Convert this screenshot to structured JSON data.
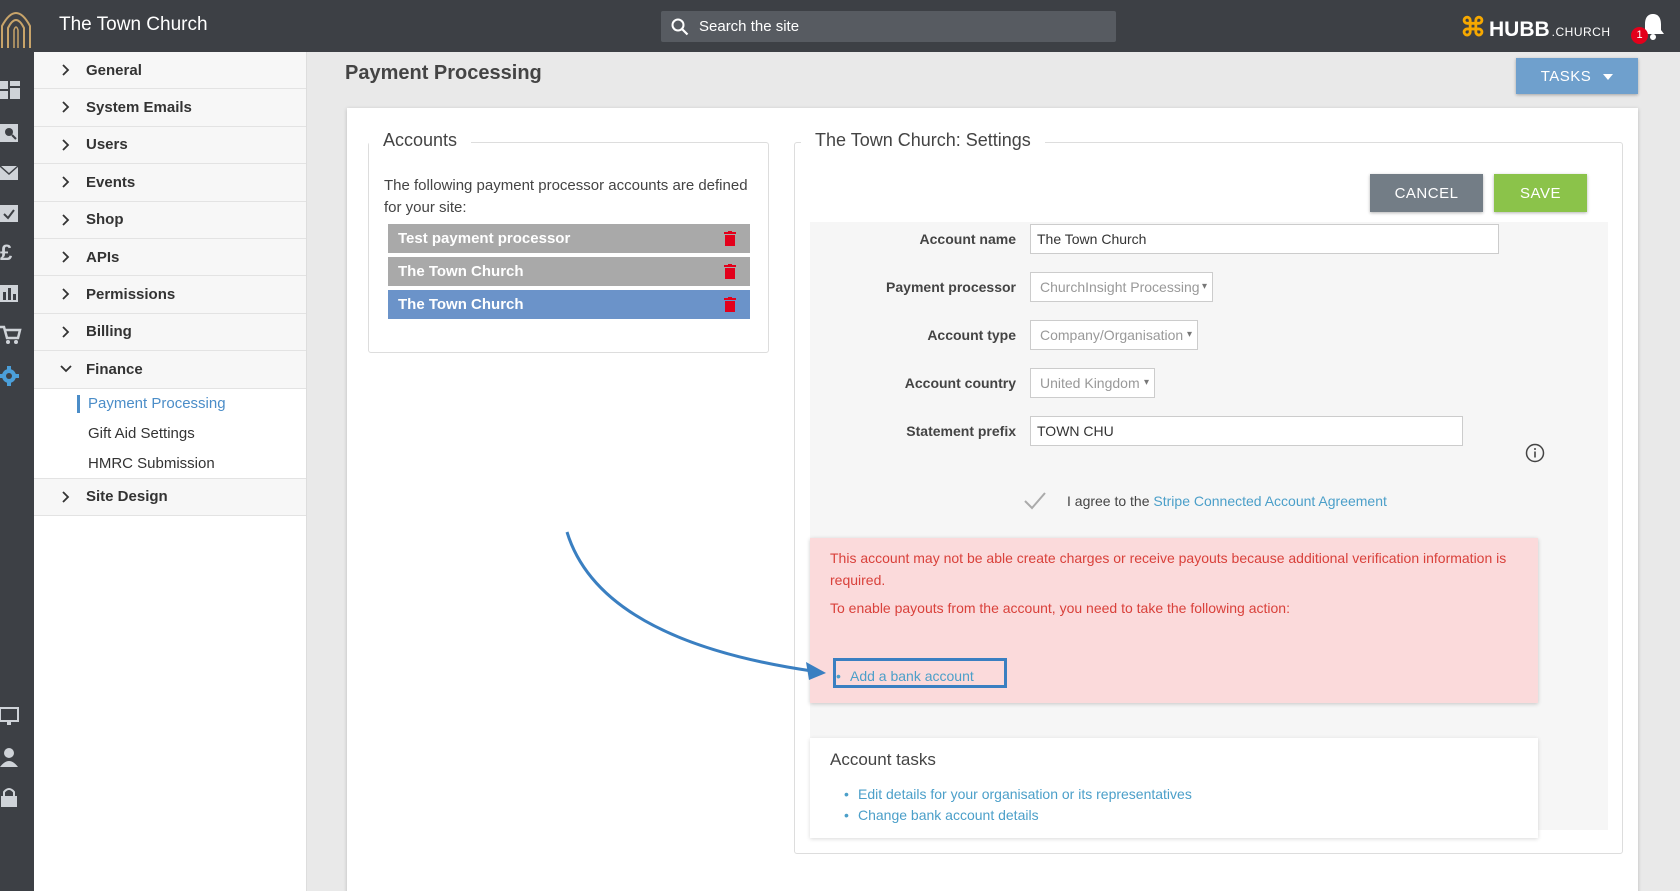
{
  "header": {
    "site_title": "The Town Church",
    "search_placeholder": "Search the site",
    "brand": "HUBB",
    "brand_suffix": ".CHURCH",
    "notification_count": "1"
  },
  "sidebar": {
    "items": [
      {
        "label": "General"
      },
      {
        "label": "System Emails"
      },
      {
        "label": "Users"
      },
      {
        "label": "Events"
      },
      {
        "label": "Shop"
      },
      {
        "label": "APIs"
      },
      {
        "label": "Permissions"
      },
      {
        "label": "Billing"
      },
      {
        "label": "Finance"
      }
    ],
    "finance_subitems": [
      {
        "label": "Payment Processing"
      },
      {
        "label": "Gift Aid Settings"
      },
      {
        "label": "HMRC Submission"
      }
    ],
    "last_item": "Site Design"
  },
  "page": {
    "title": "Payment Processing",
    "tasks_label": "TASKS"
  },
  "accounts": {
    "legend": "Accounts",
    "description": "The following payment processor accounts are defined for your site:",
    "items": [
      {
        "label": "Test payment processor"
      },
      {
        "label": "The Town Church"
      },
      {
        "label": "The Town Church"
      }
    ]
  },
  "settings": {
    "legend": "The Town Church: Settings",
    "cancel_label": "CANCEL",
    "save_label": "SAVE",
    "fields": {
      "account_name_label": "Account name",
      "account_name_value": "The Town Church",
      "payment_processor_label": "Payment processor",
      "payment_processor_value": "ChurchInsight Processing",
      "account_type_label": "Account type",
      "account_type_value": "Company/Organisation",
      "account_country_label": "Account country",
      "account_country_value": "United Kingdom",
      "statement_prefix_label": "Statement prefix",
      "statement_prefix_value": "TOWN CHU"
    },
    "agree_text": "I agree to the ",
    "agree_link": "Stripe Connected Account Agreement"
  },
  "alert": {
    "line1": "This account may not be able create charges or receive payouts because additional verification information is required.",
    "line2": "To enable payouts from the account, you need to take the following action:",
    "action_link": "Add a bank account"
  },
  "account_tasks": {
    "title": "Account tasks",
    "links": [
      {
        "label": "Edit details for your organisation or its representatives"
      },
      {
        "label": "Change bank account details"
      }
    ]
  },
  "colors": {
    "topbar": "#3d4045",
    "accent_blue": "#6b93c9",
    "save_green": "#8bc34a",
    "alert_red": "#d9413b",
    "link_blue": "#4b9fc9"
  }
}
